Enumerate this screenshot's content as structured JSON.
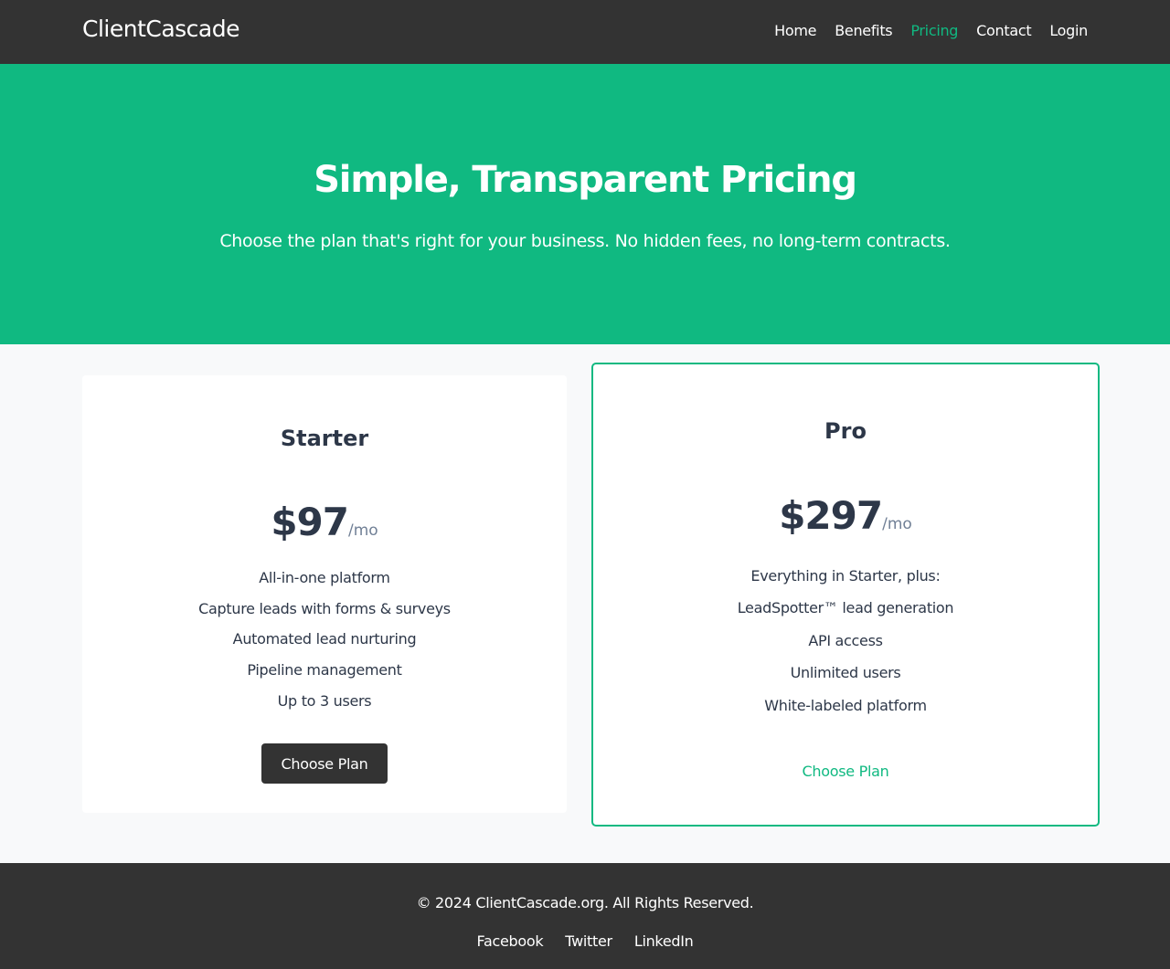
{
  "nav": {
    "brand": "ClientCascade",
    "links": [
      {
        "label": "Home"
      },
      {
        "label": "Benefits"
      },
      {
        "label": "Pricing"
      },
      {
        "label": "Contact"
      },
      {
        "label": "Login"
      }
    ],
    "active_link": "Pricing"
  },
  "hero": {
    "title": "Simple, Transparent Pricing",
    "subtitle": "Choose the plan that's right for your business. No hidden fees, no long-term contracts."
  },
  "plans": [
    {
      "name": "Starter",
      "price": "$97",
      "period": "/mo",
      "features": [
        "All-in-one platform",
        "Capture leads with forms & surveys",
        "Automated lead nurturing",
        "Pipeline management",
        "Up to 3 users"
      ],
      "cta": "Choose Plan",
      "highlighted": false
    },
    {
      "name": "Pro",
      "price": "$297",
      "period": "/mo",
      "features": [
        "Everything in Starter, plus:",
        "LeadSpotter™ lead generation",
        "API access",
        "Unlimited users",
        "White-labeled platform"
      ],
      "cta": "Choose Plan",
      "highlighted": true
    }
  ],
  "footer": {
    "copyright": "© 2024 ClientCascade.org. All Rights Reserved.",
    "social": [
      {
        "label": "Facebook"
      },
      {
        "label": "Twitter"
      },
      {
        "label": "LinkedIn"
      }
    ]
  },
  "colors": {
    "accent": "#10b981",
    "dark": "#333333",
    "text": "#2d3748",
    "muted": "#718096",
    "background": "#f8f9fa"
  }
}
